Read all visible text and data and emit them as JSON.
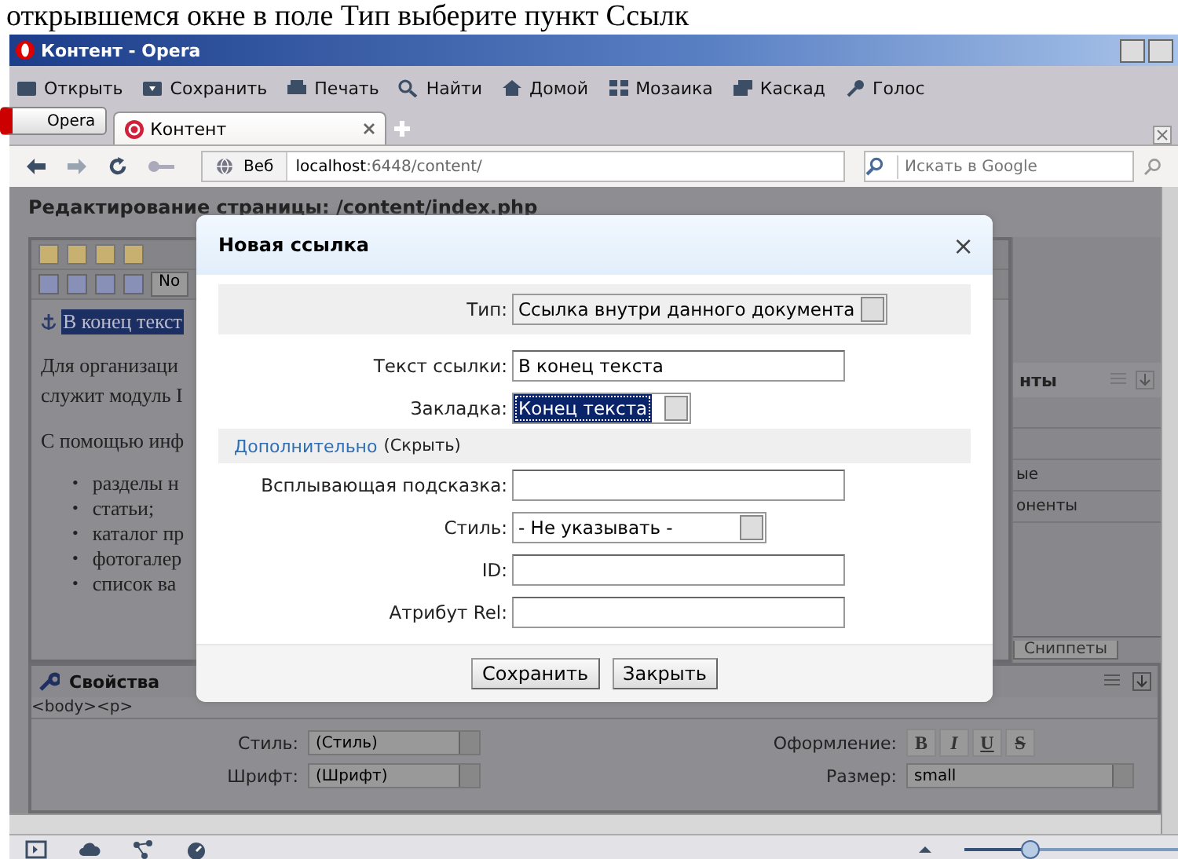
{
  "doc_caption": "открывшемся окне в поле Тип выберите пункт Ссылк",
  "window": {
    "title": "Контент - Opera"
  },
  "toolbar": [
    {
      "label": "Открыть",
      "kind": "folder"
    },
    {
      "label": "Сохранить",
      "kind": "save"
    },
    {
      "label": "Печать",
      "kind": "print"
    },
    {
      "label": "Найти",
      "kind": "search"
    },
    {
      "label": "Домой",
      "kind": "home"
    },
    {
      "label": "Мозаика",
      "kind": "tile"
    },
    {
      "label": "Каскад",
      "kind": "cascade"
    },
    {
      "label": "Голос",
      "kind": "mic"
    }
  ],
  "menu_button": "Opera",
  "tabs": [
    {
      "label": "Контент",
      "selected": true
    }
  ],
  "address": {
    "scope": "Веб",
    "host": "localhost",
    "path": ":6448/content/"
  },
  "search": {
    "placeholder": "Искать в Google"
  },
  "page": {
    "heading": "Редактирование страницы: /content/index.php",
    "format_select": "No",
    "anchor_text": "В конец текст",
    "paragraphs": [
      "Для организаци",
      "служит модуль I",
      "С помощью инф"
    ],
    "bullets": [
      {
        "marker": "•",
        "text": "разделы н"
      },
      {
        "marker": "•",
        "text": "статьи;"
      },
      {
        "marker": "•",
        "text": "каталог пр"
      },
      {
        "marker": "•",
        "text": "фотогалер"
      },
      {
        "marker": "•",
        "text": "список ва"
      }
    ],
    "side_panel": {
      "title": "нты",
      "items": [
        "ые",
        "оненты"
      ],
      "tab": "Сниппеты"
    },
    "properties": {
      "title": "Свойства",
      "path": "<body><p>",
      "style_label": "Стиль:",
      "style_value": "(Стиль)",
      "font_label": "Шрифт:",
      "font_value": "(Шрифт)",
      "format_label": "Оформление:",
      "format_buttons": [
        "B",
        "I",
        "U",
        "S"
      ],
      "size_label": "Размер:",
      "size_value": "small"
    }
  },
  "dialog": {
    "title": "Новая ссылка",
    "close": "×",
    "rows": [
      {
        "kind": "select",
        "label": "Тип:",
        "value": "Ссылка внутри данного документа",
        "shaded": true,
        "focused": false
      },
      {
        "kind": "input",
        "label": "Текст ссылки:",
        "value": "В конец текста",
        "shaded": false
      },
      {
        "kind": "select",
        "label": "Закладка:",
        "value": "Конец текста",
        "shaded": false,
        "focused": true
      },
      {
        "kind": "section",
        "link": "Дополнительно",
        "label": "(Скрыть)",
        "shaded": true
      },
      {
        "kind": "input",
        "label": "Всплывающая подсказка:",
        "value": "",
        "shaded": false
      },
      {
        "kind": "select",
        "label": "Стиль:",
        "value": "- Не указывать -",
        "shaded": false,
        "focused": false
      },
      {
        "kind": "input",
        "label": "ID:",
        "value": "",
        "shaded": false
      },
      {
        "kind": "input",
        "label": "Атрибут Rel:",
        "value": "",
        "shaded": false
      }
    ],
    "buttons": [
      "Сохранить",
      "Закрыть"
    ]
  },
  "status_bar": {
    "zoom": {
      "level": 0.3
    }
  }
}
